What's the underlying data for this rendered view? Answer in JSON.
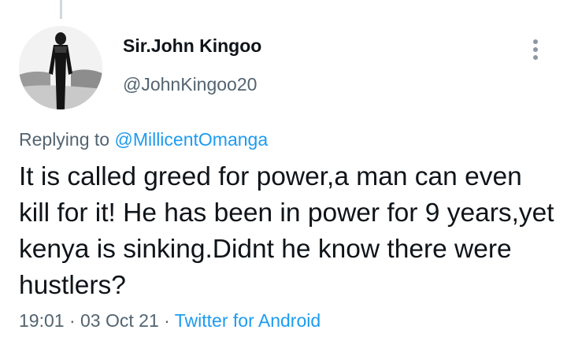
{
  "tweet": {
    "author": {
      "display_name": "Sir.John Kingoo",
      "handle": "@JohnKingoo20"
    },
    "reply": {
      "prefix": "Replying to ",
      "mention": "@MillicentOmanga"
    },
    "text": "It is called greed for power,a man can even kill for it! He has been in power for 9 years,yet kenya is sinking.Didnt he know there were hustlers?",
    "meta": {
      "time": "19:01",
      "separator": " · ",
      "date": "03 Oct 21",
      "source": "Twitter for Android"
    },
    "more_icon": "more-vertical-icon"
  },
  "colors": {
    "link": "#1d9bf0",
    "secondary_text": "#536471",
    "primary_text": "#0f1419"
  }
}
